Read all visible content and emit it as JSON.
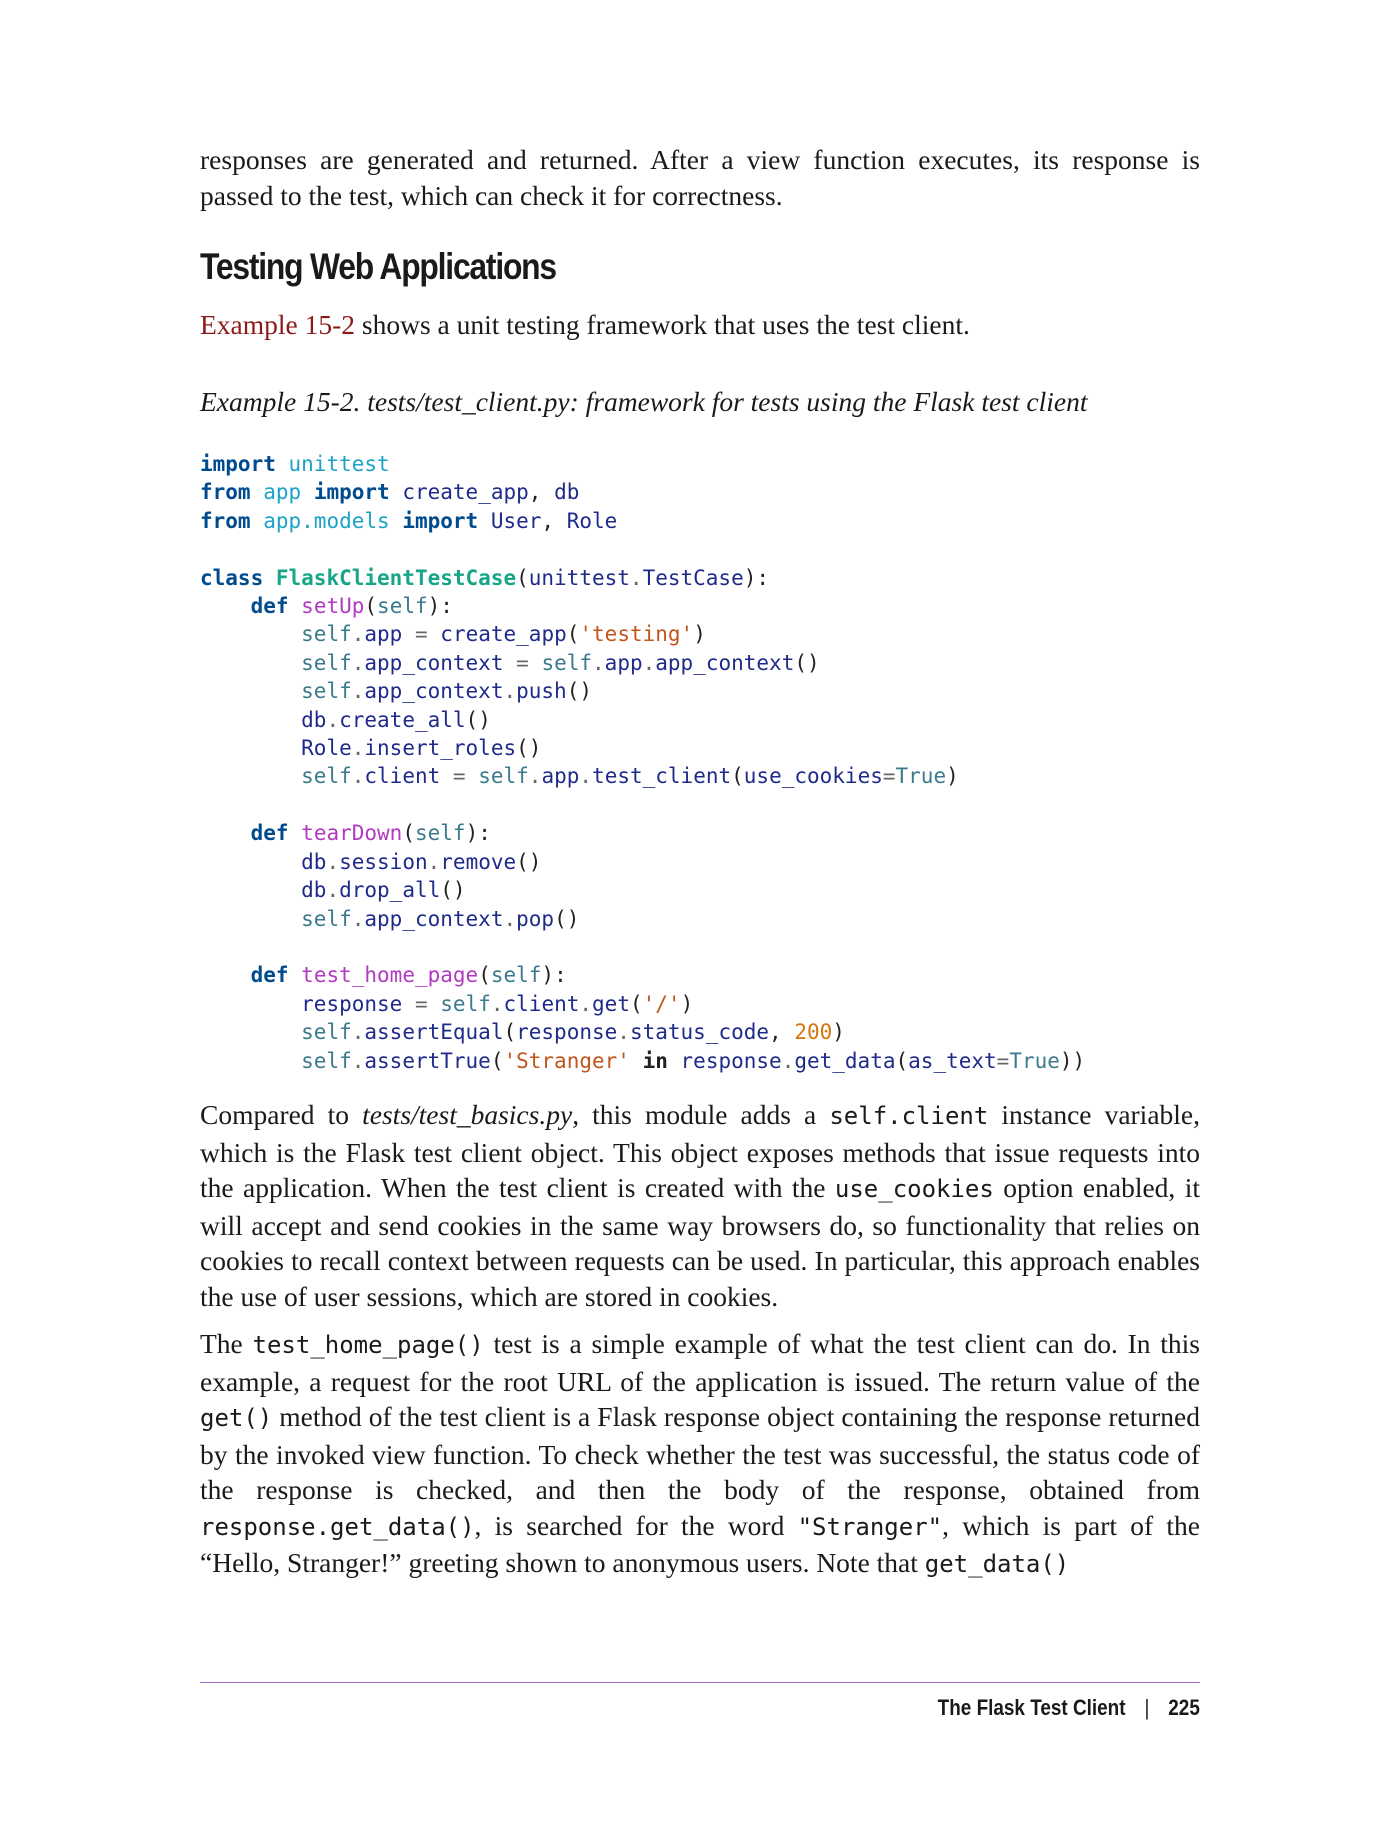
{
  "intro_paragraph": "responses are generated and returned. After a view function executes, its response is passed to the test, which can check it for correctness.",
  "section_heading": "Testing Web Applications",
  "intro2": {
    "xref": "Example 15-2",
    "rest": " shows a unit testing framework that uses the test client."
  },
  "example_caption": "Example 15-2. tests/test_client.py: framework for tests using the Flask test client",
  "code_lines": [
    "import unittest",
    "from app import create_app, db",
    "from app.models import User, Role",
    "",
    "class FlaskClientTestCase(unittest.TestCase):",
    "    def setUp(self):",
    "        self.app = create_app('testing')",
    "        self.app_context = self.app.app_context()",
    "        self.app_context.push()",
    "        db.create_all()",
    "        Role.insert_roles()",
    "        self.client = self.app.test_client(use_cookies=True)",
    "",
    "    def tearDown(self):",
    "        db.session.remove()",
    "        db.drop_all()",
    "        self.app_context.pop()",
    "",
    "    def test_home_page(self):",
    "        response = self.client.get('/')",
    "        self.assertEqual(response.status_code, 200)",
    "        self.assertTrue('Stranger' in response.get_data(as_text=True))"
  ],
  "paragraph3": {
    "t1": "Compared to ",
    "em1": "tests/test_basics.py",
    "t2": ", this module adds a ",
    "code1": "self.client",
    "t3": " instance variable, which is the Flask test client object. This object exposes methods that issue requests into the application. When the test client is created with the ",
    "code2": "use_cookies",
    "t4": " option enabled, it will accept and send cookies in the same way browsers do, so functionality that relies on cookies to recall context between requests can be used. In particular, this approach enables the use of user sessions, which are stored in cookies."
  },
  "paragraph4": {
    "t1": "The ",
    "code1": "test_home_page()",
    "t2": " test is a simple example of what the test client can do. In this example, a request for the root URL of the application is issued. The return value of the ",
    "code2": "get()",
    "t3": " method of the test client is a Flask response object containing the response returned by the invoked view function. To check whether the test was successful, the status code of the response is checked, and then the body of the response, obtained from ",
    "code3": "response.get_data()",
    "t4": ", is searched for the word ",
    "code4": "\"Stranger\"",
    "t5": ", which is part of the “Hello, Stranger!” greeting shown to anonymous users. Note that ",
    "code5": "get_data()"
  },
  "footer": {
    "section_title": "The Flask Test Client",
    "separator": "|",
    "page_number": "225"
  },
  "colors": {
    "xref": "#8b1a1a",
    "footer_rule": "#a06ac9",
    "keyword": "#004b8d",
    "module": "#1ba3c6",
    "class_name": "#17a589",
    "function_name": "#b23ac2",
    "string": "#c0561a",
    "number": "#d5760a"
  }
}
